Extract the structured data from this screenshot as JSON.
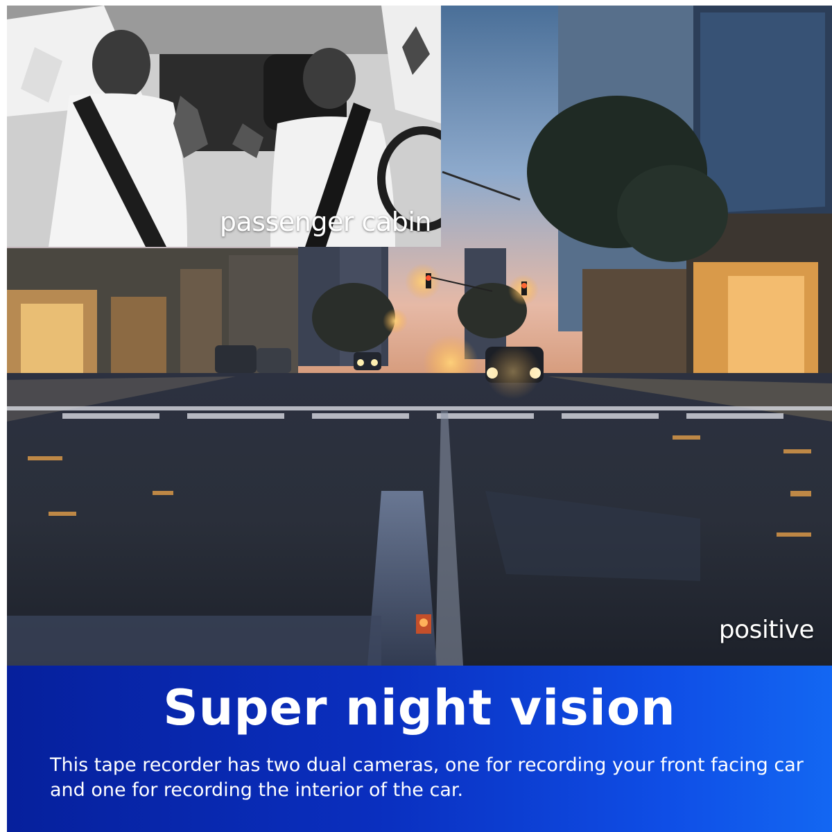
{
  "inset": {
    "label": "passenger cabin"
  },
  "scene": {
    "mode_label": "positive"
  },
  "banner": {
    "headline": "Super night vision",
    "body": "This tape recorder has two dual cameras, one for recording your front facing car and one for recording the interior of the car."
  },
  "colors": {
    "banner_start": "#06209c",
    "banner_end": "#1367f2",
    "text": "#ffffff"
  }
}
